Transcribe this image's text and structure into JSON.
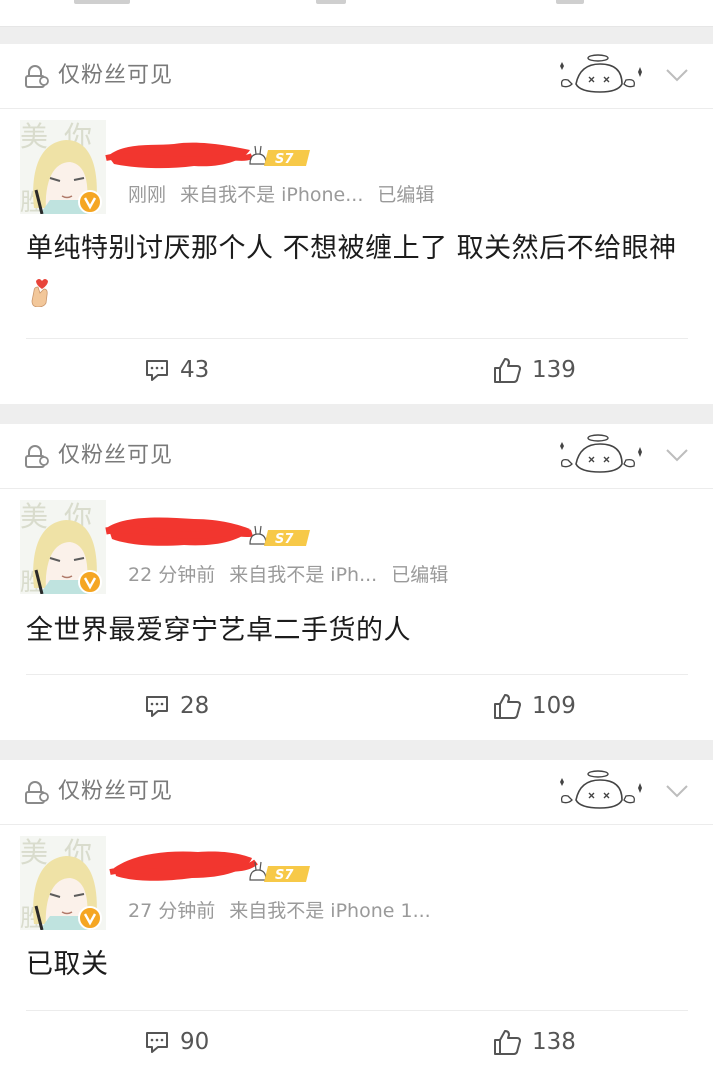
{
  "posts": [
    {
      "visibility": "仅粉丝可见",
      "level_badge": "S7",
      "time": "刚刚",
      "source": "来自我不是 iPhone...",
      "edited": "已编辑",
      "content": "单纯特别讨厌那个人 不想被缠上了 取关然后不给眼神",
      "content_emoji": "crossed-fingers-heart-emoji",
      "comments": "43",
      "likes": "139"
    },
    {
      "visibility": "仅粉丝可见",
      "level_badge": "S7",
      "time": "22 分钟前",
      "source": "来自我不是 iPh...",
      "edited": "已编辑",
      "content": "全世界最爱穿宁艺卓二手货的人",
      "comments": "28",
      "likes": "109"
    },
    {
      "visibility": "仅粉丝可见",
      "level_badge": "S7",
      "time": "27 分钟前",
      "source": "来自我不是 iPhone 1...",
      "edited": "",
      "content": "已取关",
      "comments": "90",
      "likes": "138"
    }
  ],
  "colors": {
    "redaction": "#f2362f",
    "verified_badge": "#f5a623",
    "level_badge": "#f7c948",
    "meta_text": "#9a9a9a",
    "page_bg": "#eeeeee"
  }
}
